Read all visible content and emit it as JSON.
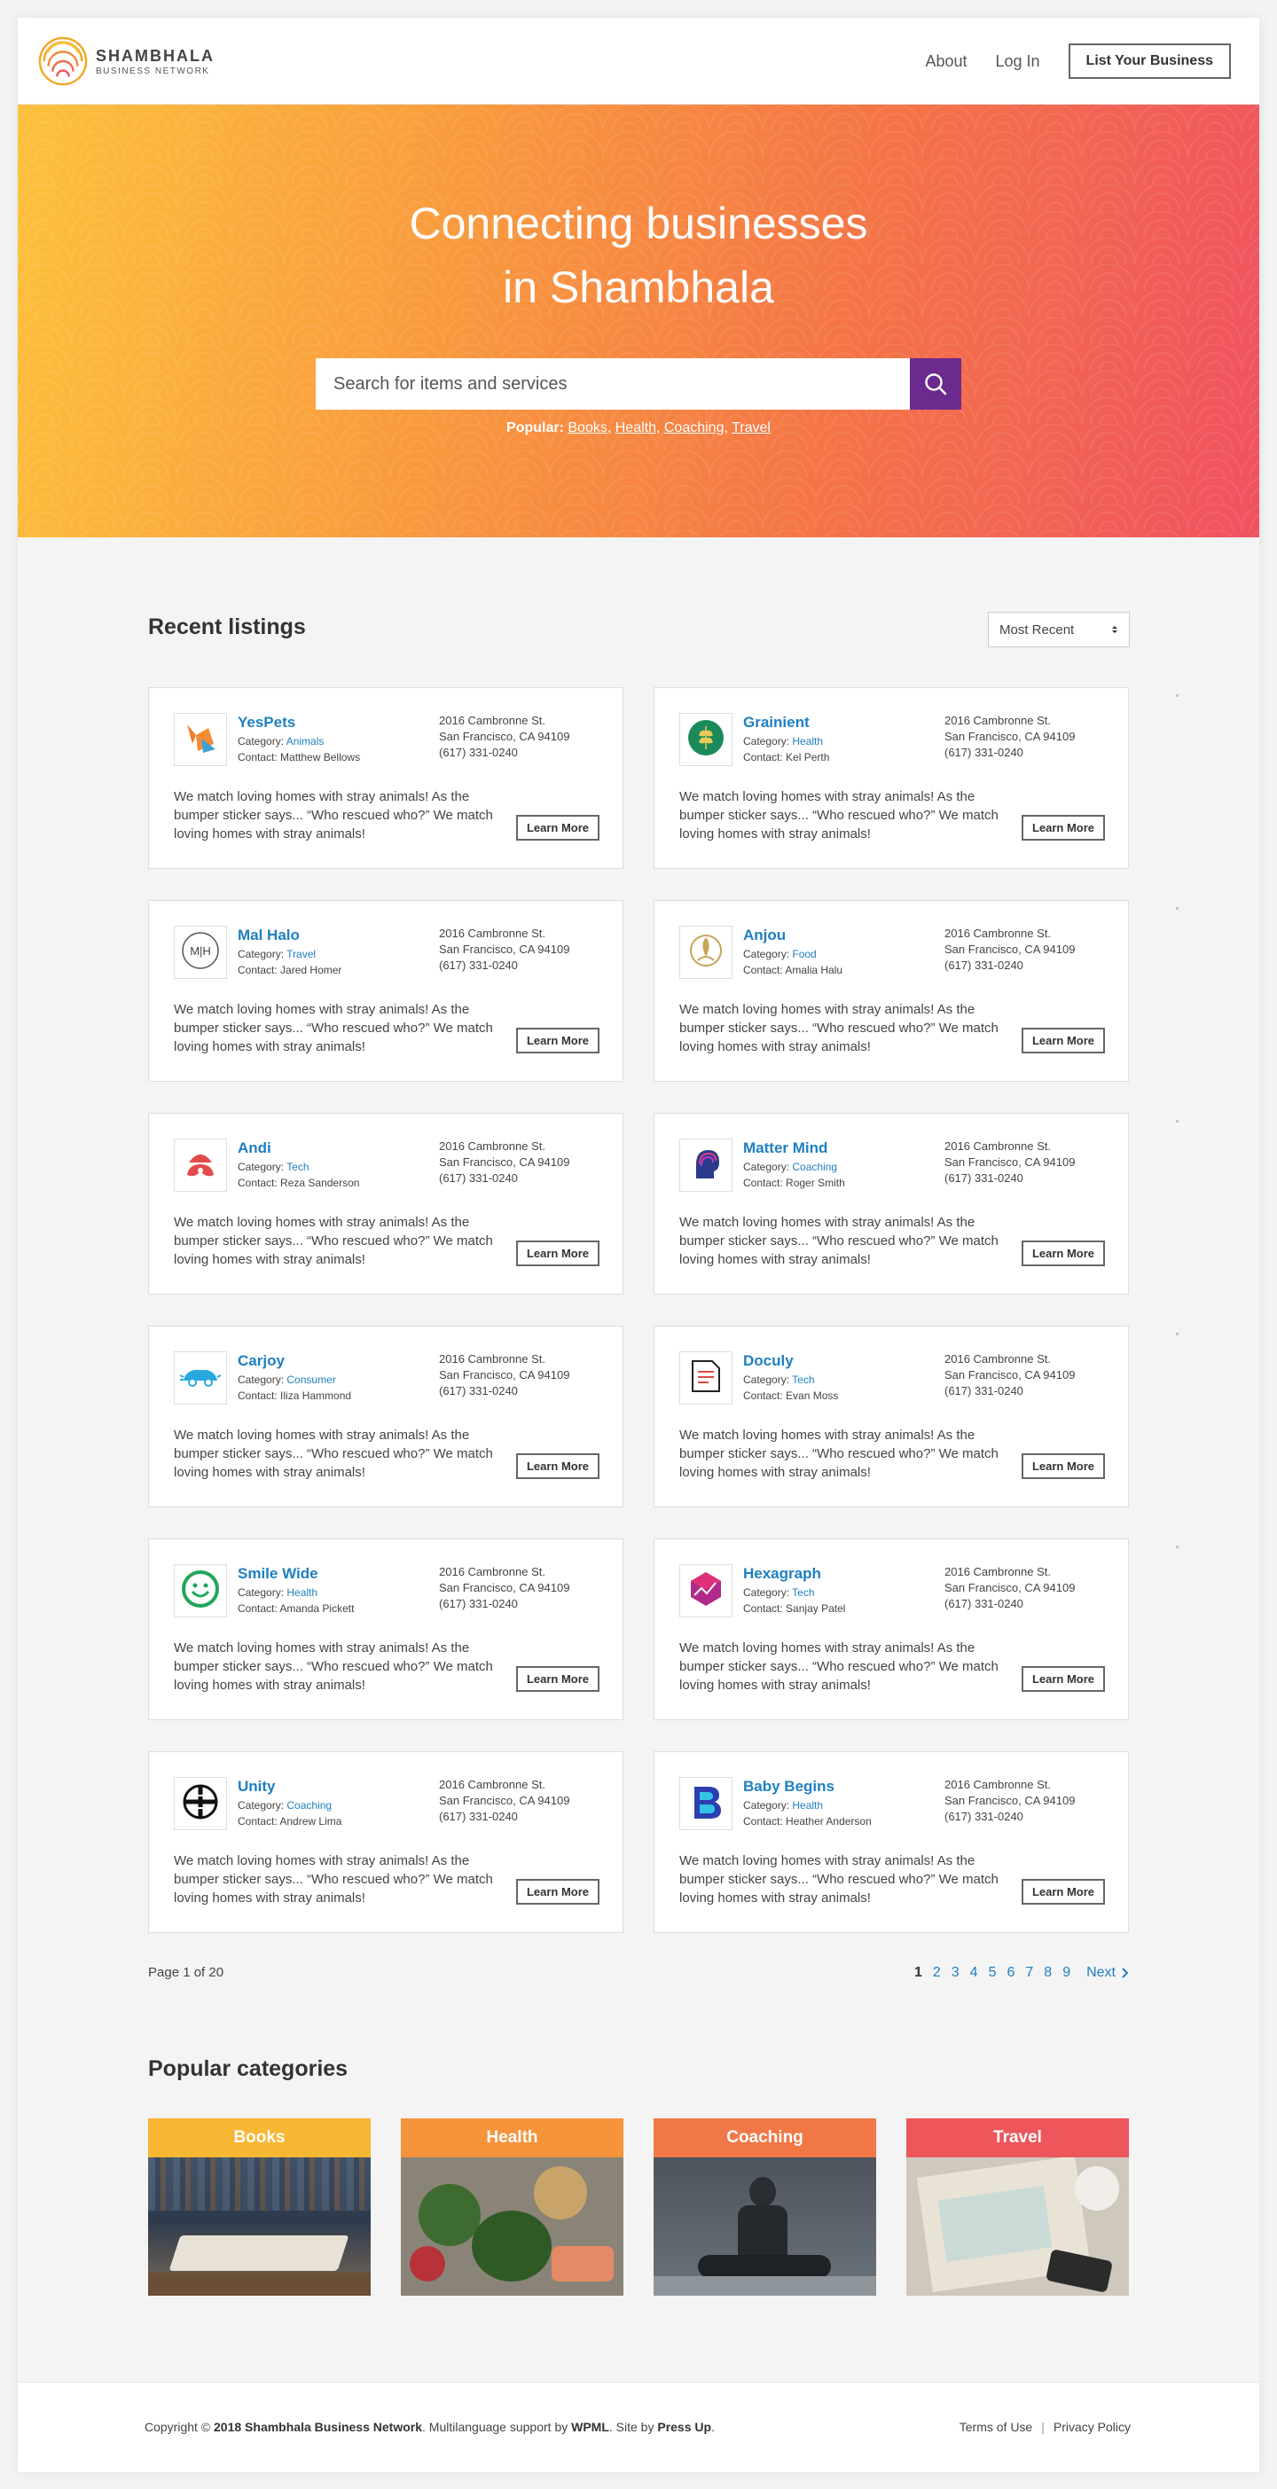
{
  "header": {
    "logo_title": "SHAMBHALA",
    "logo_subtitle": "BUSINESS NETWORK",
    "nav": {
      "about": "About",
      "login": "Log In",
      "cta": "List Your Business"
    }
  },
  "hero": {
    "title_line1": "Connecting businesses",
    "title_line2": "in Shambhala",
    "search_placeholder": "Search for items and services",
    "popular_label": "Popular:",
    "popular_links": [
      "Books",
      "Health",
      "Coaching",
      "Travel"
    ]
  },
  "listings": {
    "title": "Recent listings",
    "sort": "Most Recent",
    "learn_more": "Learn More",
    "category_prefix": "Category:",
    "contact_prefix": "Contact:",
    "items": [
      {
        "name": "YesPets",
        "category": "Animals",
        "contact": "Matthew Bellows",
        "addr1": "2016 Cambronne St.",
        "addr2": "San Francisco, CA 94109",
        "phone": "(617) 331-0240",
        "desc": "We match loving homes with stray animals! As the bumper sticker says... “Who rescued who?” We match loving homes with stray animals!"
      },
      {
        "name": "Grainient",
        "category": "Health",
        "contact": "Kel Perth",
        "addr1": "2016 Cambronne St.",
        "addr2": "San Francisco, CA 94109",
        "phone": "(617) 331-0240",
        "desc": "We match loving homes with stray animals! As the bumper sticker says... “Who rescued who?” We match loving homes with stray animals!"
      },
      {
        "name": "Mal Halo",
        "category": "Travel",
        "contact": "Jared Homer",
        "addr1": "2016 Cambronne St.",
        "addr2": "San Francisco, CA 94109",
        "phone": "(617) 331-0240",
        "desc": "We match loving homes with stray animals! As the bumper sticker says... “Who rescued who?” We match loving homes with stray animals!"
      },
      {
        "name": "Anjou",
        "category": "Food",
        "contact": "Amalia Halu",
        "addr1": "2016 Cambronne St.",
        "addr2": "San Francisco, CA 94109",
        "phone": "(617) 331-0240",
        "desc": "We match loving homes with stray animals! As the bumper sticker says... “Who rescued who?” We match loving homes with stray animals!"
      },
      {
        "name": "Andi",
        "category": "Tech",
        "contact": "Reza Sanderson",
        "addr1": "2016 Cambronne St.",
        "addr2": "San Francisco, CA 94109",
        "phone": "(617) 331-0240",
        "desc": "We match loving homes with stray animals! As the bumper sticker says... “Who rescued who?” We match loving homes with stray animals!"
      },
      {
        "name": "Matter Mind",
        "category": "Coaching",
        "contact": "Roger Smith",
        "addr1": "2016 Cambronne St.",
        "addr2": "San Francisco, CA 94109",
        "phone": "(617) 331-0240",
        "desc": "We match loving homes with stray animals! As the bumper sticker says... “Who rescued who?” We match loving homes with stray animals!"
      },
      {
        "name": "Carjoy",
        "category": "Consumer",
        "contact": "Iliza Hammond",
        "addr1": "2016 Cambronne St.",
        "addr2": "San Francisco, CA 94109",
        "phone": "(617) 331-0240",
        "desc": "We match loving homes with stray animals! As the bumper sticker says... “Who rescued who?” We match loving homes with stray animals!"
      },
      {
        "name": "Doculy",
        "category": "Tech",
        "contact": "Evan Moss",
        "addr1": "2016 Cambronne St.",
        "addr2": "San Francisco, CA 94109",
        "phone": "(617) 331-0240",
        "desc": "We match loving homes with stray animals! As the bumper sticker says... “Who rescued who?” We match loving homes with stray animals!"
      },
      {
        "name": "Smile Wide",
        "category": "Health",
        "contact": "Amanda Pickett",
        "addr1": "2016 Cambronne St.",
        "addr2": "San Francisco, CA 94109",
        "phone": "(617) 331-0240",
        "desc": "We match loving homes with stray animals! As the bumper sticker says... “Who rescued who?” We match loving homes with stray animals!"
      },
      {
        "name": "Hexagraph",
        "category": "Tech",
        "contact": "Sanjay Patel",
        "addr1": "2016 Cambronne St.",
        "addr2": "San Francisco, CA 94109",
        "phone": "(617) 331-0240",
        "desc": "We match loving homes with stray animals! As the bumper sticker says... “Who rescued who?” We match loving homes with stray animals!"
      },
      {
        "name": "Unity",
        "category": "Coaching",
        "contact": "Andrew Lima",
        "addr1": "2016 Cambronne St.",
        "addr2": "San Francisco, CA 94109",
        "phone": "(617) 331-0240",
        "desc": "We match loving homes with stray animals! As the bumper sticker says... “Who rescued who?” We match loving homes with stray animals!"
      },
      {
        "name": "Baby Begins",
        "category": "Health",
        "contact": "Heather Anderson",
        "addr1": "2016 Cambronne St.",
        "addr2": "San Francisco, CA 94109",
        "phone": "(617) 331-0240",
        "desc": "We match loving homes with stray animals! As the bumper sticker says... “Who rescued who?” We match loving homes with stray animals!"
      }
    ]
  },
  "pagination": {
    "info": "Page 1 of 20",
    "pages": [
      "1",
      "2",
      "3",
      "4",
      "5",
      "6",
      "7",
      "8",
      "9"
    ],
    "current": "1",
    "next": "Next"
  },
  "categories": {
    "title": "Popular categories",
    "items": [
      {
        "label": "Books",
        "color": "#f7b733"
      },
      {
        "label": "Health",
        "color": "#f6943b"
      },
      {
        "label": "Coaching",
        "color": "#f27747"
      },
      {
        "label": "Travel",
        "color": "#ee565c"
      }
    ]
  },
  "footer": {
    "copyright_prefix": "Copyright © ",
    "company": "2018 Shambhala Business Network",
    "multilang": ". Multilanguage support by ",
    "wpml": "WPML",
    "site_by": ". Site by ",
    "pressup": "Press Up",
    "end": ".",
    "terms": "Terms of Use",
    "separator": "|",
    "privacy": "Privacy Policy"
  },
  "colors": {
    "accent": "#1f7fc1",
    "search_button": "#6b2a8e"
  }
}
